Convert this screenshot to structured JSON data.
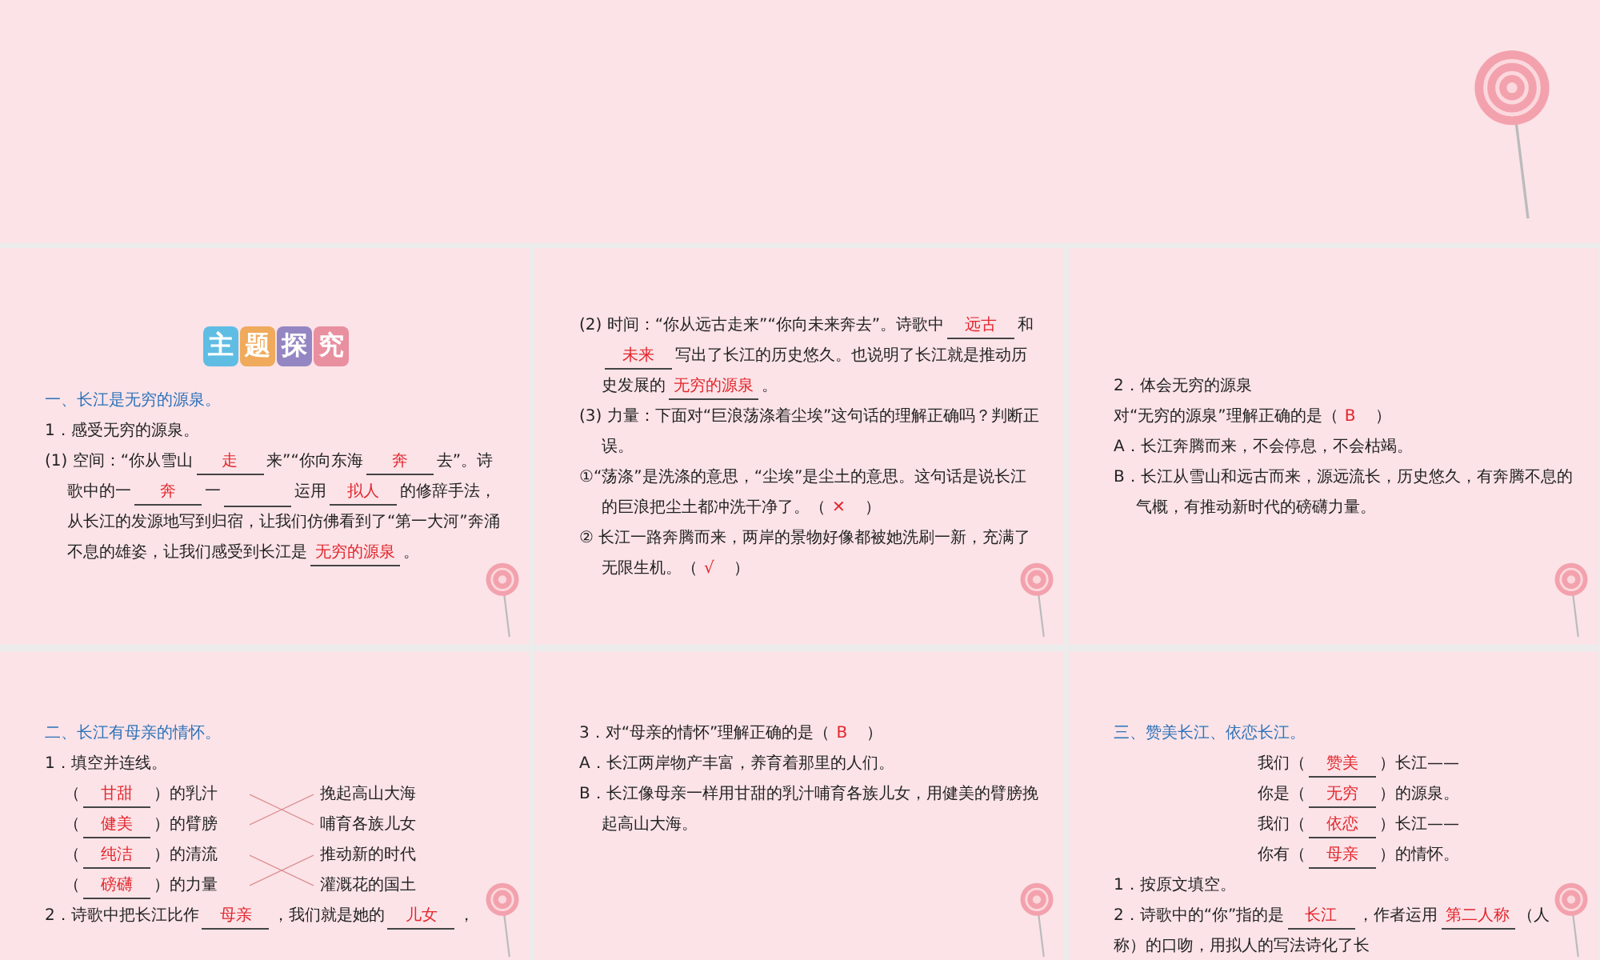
{
  "title_badge": [
    {
      "char": "主",
      "color": "#5fbde3"
    },
    {
      "char": "题",
      "color": "#f0aa5c"
    },
    {
      "char": "探",
      "color": "#9486c2"
    },
    {
      "char": "究",
      "color": "#e88fa0"
    }
  ],
  "slides": [
    {
      "badge": true,
      "lines": [
        {
          "kind": "heading",
          "parts": [
            {
              "text": "一、长江是无穷的源泉。"
            }
          ]
        },
        {
          "kind": "text",
          "parts": [
            {
              "text": "1．感受无穷的源泉。"
            }
          ]
        },
        {
          "kind": "hang",
          "parts": [
            {
              "text": "(1) 空间：“你从雪山"
            },
            {
              "answer": "走"
            },
            {
              "text": "来”“你向东海"
            },
            {
              "answer": "奔"
            },
            {
              "text": "去”。诗歌中的一"
            },
            {
              "answer": "奔"
            },
            {
              "text": "一"
            },
            {
              "blank": true
            },
            {
              "text": "运用"
            },
            {
              "answer": "拟人"
            },
            {
              "text": "的修辞手法，从长江的发源地写到归宿，让我们仿佛看到了“第一大河”奔涌不息的雄姿，让我们感受到长江是"
            },
            {
              "answer": "无穷的源泉"
            },
            {
              "text": "。"
            }
          ]
        }
      ]
    },
    {
      "lines": [
        {
          "kind": "hang",
          "parts": [
            {
              "text": "(2) 时间：“你从远古走来”“你向未来奔去”。诗歌中"
            },
            {
              "answer": "远古"
            },
            {
              "text": "和"
            },
            {
              "answer": "未来"
            },
            {
              "text": "写出了长江的历史悠久。也说明了长江就是推动历史发展的"
            },
            {
              "answer": "无穷的源泉"
            },
            {
              "text": "。"
            }
          ]
        },
        {
          "kind": "hang",
          "parts": [
            {
              "text": "(3) 力量：下面对“巨浪荡涤着尘埃”这句话的理解正确吗？判断正误。"
            }
          ]
        },
        {
          "kind": "hang",
          "parts": [
            {
              "text": "①“荡涤”是洗涤的意思，“尘埃”是尘土的意思。这句话是说长江的巨浪把尘土都冲洗干净了。（"
            },
            {
              "mark": "✕"
            },
            {
              "text": "）"
            }
          ]
        },
        {
          "kind": "hang",
          "parts": [
            {
              "text": "② 长江一路奔腾而来，两岸的景物好像都被她洗刷一新，充满了无限生机。（"
            },
            {
              "mark": "√"
            },
            {
              "text": "）"
            }
          ]
        }
      ]
    },
    {
      "lines": [
        {
          "kind": "text",
          "parts": [
            {
              "text": "2．体会无穷的源泉"
            }
          ]
        },
        {
          "kind": "text",
          "parts": [
            {
              "text": "对“无穷的源泉”理解正确的是（"
            },
            {
              "mark": "B"
            },
            {
              "text": "）"
            }
          ]
        },
        {
          "kind": "hang",
          "parts": [
            {
              "text": "A．长江奔腾而来，不会停息，不会枯竭。"
            }
          ]
        },
        {
          "kind": "hang",
          "parts": [
            {
              "text": "B．长江从雪山和远古而来，源远流长，历史悠久，有奔腾不息的气概，有推动新时代的磅礴力量。"
            }
          ]
        }
      ]
    },
    {
      "lines": [
        {
          "kind": "heading",
          "parts": [
            {
              "text": "二、长江有母亲的情怀。"
            }
          ]
        },
        {
          "kind": "text",
          "parts": [
            {
              "text": "1．填空并连线。"
            }
          ]
        },
        {
          "kind": "matching",
          "rows": [
            {
              "open": "（",
              "answer": "甘甜",
              "left": "）的乳汁",
              "right": "挽起高山大海"
            },
            {
              "open": "（",
              "answer": "健美",
              "left": "）的臂膀",
              "right": "哺育各族儿女"
            },
            {
              "open": "（",
              "answer": "纯洁",
              "left": "）的清流",
              "right": "推动新的时代"
            },
            {
              "open": "（",
              "answer": "磅礴",
              "left": "）的力量",
              "right": "灌溉花的国土"
            }
          ]
        },
        {
          "kind": "text",
          "parts": [
            {
              "text": "2．诗歌中把长江比作"
            },
            {
              "answer": "母亲"
            },
            {
              "text": "，我们就是她的"
            },
            {
              "answer": "儿女"
            },
            {
              "text": "，"
            }
          ]
        }
      ]
    },
    {
      "lines": [
        {
          "kind": "text",
          "parts": [
            {
              "text": "3．对“母亲的情怀”理解正确的是（"
            },
            {
              "mark": "B"
            },
            {
              "text": "）"
            }
          ]
        },
        {
          "kind": "hang",
          "parts": [
            {
              "text": "A．长江两岸物产丰富，养育着那里的人们。"
            }
          ]
        },
        {
          "kind": "hang",
          "parts": [
            {
              "text": "B．长江像母亲一样用甘甜的乳汁哺育各族儿女，用健美的臂膀挽起高山大海。"
            }
          ]
        }
      ]
    },
    {
      "lines": [
        {
          "kind": "heading",
          "parts": [
            {
              "text": "三、赞美长江、依恋长江。"
            }
          ]
        },
        {
          "kind": "poem",
          "parts": [
            {
              "text": "我们（"
            },
            {
              "answer": "赞美"
            },
            {
              "text": "）长江——"
            }
          ]
        },
        {
          "kind": "poem",
          "parts": [
            {
              "text": "你是（"
            },
            {
              "answer": "无穷"
            },
            {
              "text": "）的源泉。"
            }
          ]
        },
        {
          "kind": "poem",
          "parts": [
            {
              "text": "我们（"
            },
            {
              "answer": "依恋"
            },
            {
              "text": "）长江——"
            }
          ]
        },
        {
          "kind": "poem",
          "parts": [
            {
              "text": "你有（"
            },
            {
              "answer": "母亲"
            },
            {
              "text": "）的情怀。"
            }
          ]
        },
        {
          "kind": "text",
          "parts": [
            {
              "text": "1．按原文填空。"
            }
          ]
        },
        {
          "kind": "text",
          "parts": [
            {
              "text": "2．诗歌中的“你”指的是"
            },
            {
              "answer": "长江"
            },
            {
              "text": "，作者运用"
            },
            {
              "answer": "第二人称"
            },
            {
              "text": "（人称）的口吻，用拟人的写法诗化了长"
            }
          ]
        }
      ]
    }
  ]
}
